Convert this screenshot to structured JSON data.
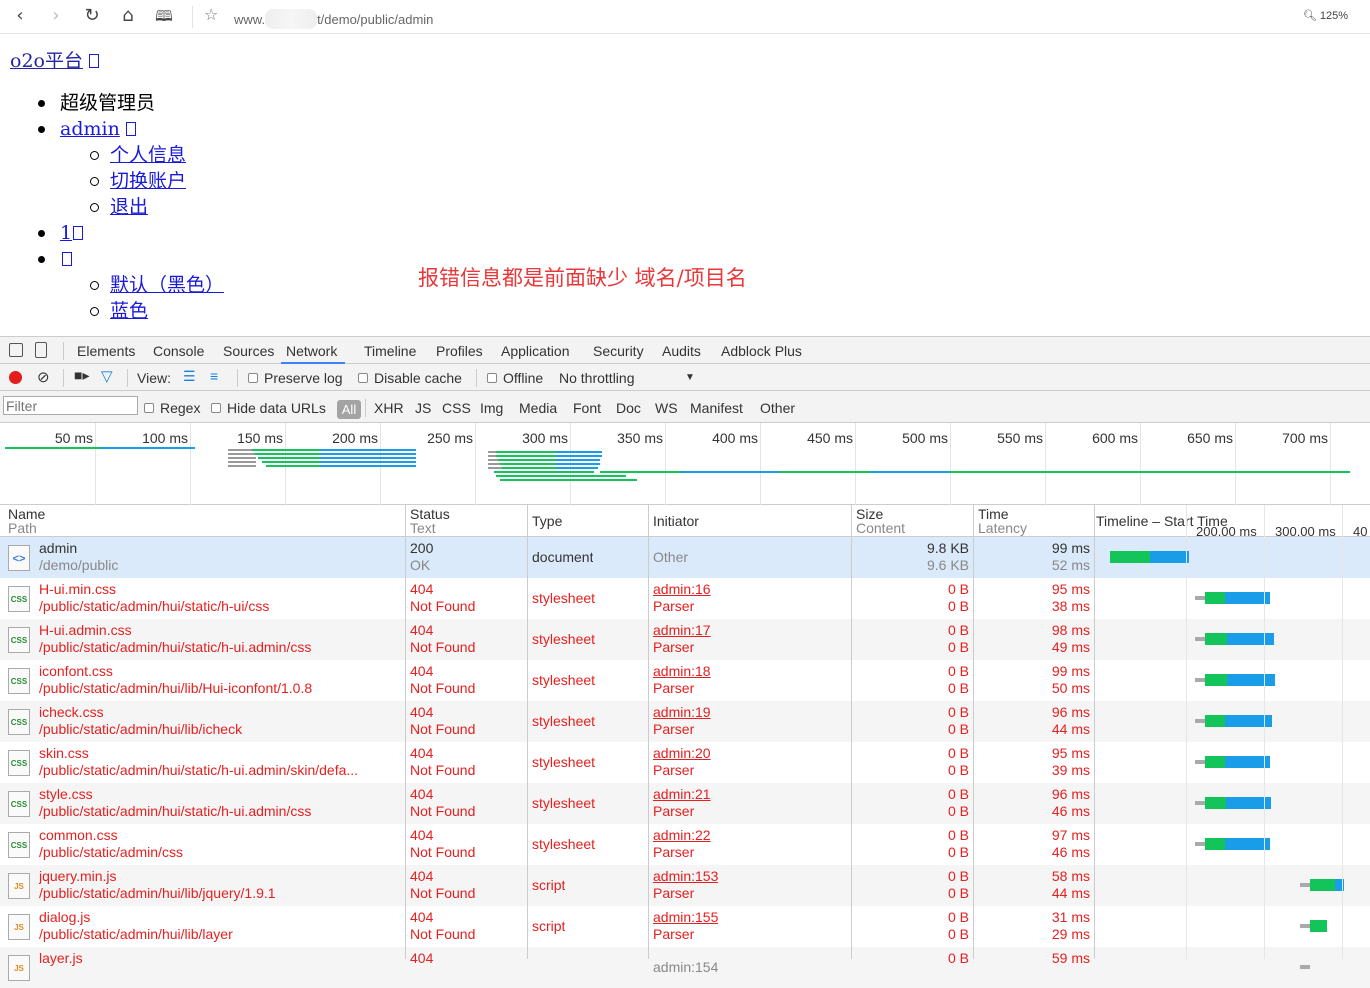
{
  "browser": {
    "url_prefix": "www.",
    "url_suffix": "t/demo/public/admin",
    "zoom": "125%"
  },
  "page": {
    "logo": "o2o平台",
    "menu": {
      "role": "超级管理员",
      "user": "admin",
      "user_items": [
        "个人信息",
        "切换账户",
        "退出"
      ],
      "count": "1",
      "skin_items": [
        "默认（黑色）",
        "蓝色"
      ]
    },
    "note": "报错信息都是前面缺少 域名/项目名"
  },
  "devtools": {
    "tabs": [
      "Elements",
      "Console",
      "Sources",
      "Network",
      "Timeline",
      "Profiles",
      "Application",
      "Security",
      "Audits",
      "Adblock Plus"
    ],
    "active_tab": "Network",
    "toolbar": {
      "view": "View:",
      "preserve_log": "Preserve log",
      "disable_cache": "Disable cache",
      "offline": "Offline",
      "throttling": "No throttling"
    },
    "filter": {
      "placeholder": "Filter",
      "regex": "Regex",
      "hide_data_urls": "Hide data URLs",
      "all": "All",
      "types": [
        "XHR",
        "JS",
        "CSS",
        "Img",
        "Media",
        "Font",
        "Doc",
        "WS",
        "Manifest",
        "Other"
      ]
    },
    "overview_ticks": [
      "50 ms",
      "100 ms",
      "150 ms",
      "200 ms",
      "250 ms",
      "300 ms",
      "350 ms",
      "400 ms",
      "450 ms",
      "500 ms",
      "550 ms",
      "600 ms",
      "650 ms",
      "700 ms"
    ],
    "columns": {
      "name": "Name",
      "name_sub": "Path",
      "status": "Status",
      "status_sub": "Text",
      "type": "Type",
      "initiator": "Initiator",
      "size": "Size",
      "size_sub": "Content",
      "time": "Time",
      "time_sub": "Latency",
      "timeline": "Timeline – Start Time",
      "timeline_ticks": [
        "200.00 ms",
        "300.00 ms",
        "40"
      ]
    },
    "requests": [
      {
        "icon": "doc",
        "name": "admin",
        "path": "/demo/public",
        "status": "200",
        "status_text": "OK",
        "type": "document",
        "initiator": "Other",
        "initiator_sub": "",
        "size": "9.8 KB",
        "content": "9.6 KB",
        "time": "99 ms",
        "latency": "52 ms",
        "wf_start": 0,
        "wf_wait": 99,
        "wf_recv": 52
      },
      {
        "icon": "css",
        "name": "H-ui.min.css",
        "path": "/public/static/admin/hui/static/h-ui/css",
        "status": "404",
        "status_text": "Not Found",
        "type": "stylesheet",
        "initiator": "admin:16",
        "initiator_sub": "Parser",
        "size": "0 B",
        "content": "0 B",
        "time": "95 ms",
        "latency": "38 ms",
        "wf_start": 100,
        "wf_wait": 25,
        "wf_recv": 60
      },
      {
        "icon": "css",
        "name": "H-ui.admin.css",
        "path": "/public/static/admin/hui/static/h-ui.admin/css",
        "status": "404",
        "status_text": "Not Found",
        "type": "stylesheet",
        "initiator": "admin:17",
        "initiator_sub": "Parser",
        "size": "0 B",
        "content": "0 B",
        "time": "98 ms",
        "latency": "49 ms",
        "wf_start": 100,
        "wf_wait": 28,
        "wf_recv": 62
      },
      {
        "icon": "css",
        "name": "iconfont.css",
        "path": "/public/static/admin/hui/lib/Hui-iconfont/1.0.8",
        "status": "404",
        "status_text": "Not Found",
        "type": "stylesheet",
        "initiator": "admin:18",
        "initiator_sub": "Parser",
        "size": "0 B",
        "content": "0 B",
        "time": "99 ms",
        "latency": "50 ms",
        "wf_start": 100,
        "wf_wait": 28,
        "wf_recv": 64
      },
      {
        "icon": "css",
        "name": "icheck.css",
        "path": "/public/static/admin/hui/lib/icheck",
        "status": "404",
        "status_text": "Not Found",
        "type": "stylesheet",
        "initiator": "admin:19",
        "initiator_sub": "Parser",
        "size": "0 B",
        "content": "0 B",
        "time": "96 ms",
        "latency": "44 ms",
        "wf_start": 100,
        "wf_wait": 25,
        "wf_recv": 62
      },
      {
        "icon": "css",
        "name": "skin.css",
        "path": "/public/static/admin/hui/static/h-ui.admin/skin/defa...",
        "status": "404",
        "status_text": "Not Found",
        "type": "stylesheet",
        "initiator": "admin:20",
        "initiator_sub": "Parser",
        "size": "0 B",
        "content": "0 B",
        "time": "95 ms",
        "latency": "39 ms",
        "wf_start": 100,
        "wf_wait": 25,
        "wf_recv": 60
      },
      {
        "icon": "css",
        "name": "style.css",
        "path": "/public/static/admin/hui/static/h-ui.admin/css",
        "status": "404",
        "status_text": "Not Found",
        "type": "stylesheet",
        "initiator": "admin:21",
        "initiator_sub": "Parser",
        "size": "0 B",
        "content": "0 B",
        "time": "96 ms",
        "latency": "46 ms",
        "wf_start": 100,
        "wf_wait": 26,
        "wf_recv": 60
      },
      {
        "icon": "css",
        "name": "common.css",
        "path": "/public/static/admin/css",
        "status": "404",
        "status_text": "Not Found",
        "type": "stylesheet",
        "initiator": "admin:22",
        "initiator_sub": "Parser",
        "size": "0 B",
        "content": "0 B",
        "time": "97 ms",
        "latency": "46 ms",
        "wf_start": 100,
        "wf_wait": 25,
        "wf_recv": 60
      },
      {
        "icon": "js",
        "name": "jquery.min.js",
        "path": "/public/static/admin/hui/lib/jquery/1.9.1",
        "status": "404",
        "status_text": "Not Found",
        "type": "script",
        "initiator": "admin:153",
        "initiator_sub": "Parser",
        "size": "0 B",
        "content": "0 B",
        "time": "58 ms",
        "latency": "44 ms",
        "wf_start": 210,
        "wf_wait": 32,
        "wf_recv": 12
      },
      {
        "icon": "js",
        "name": "dialog.js",
        "path": "/public/static/admin/hui/lib/layer",
        "status": "404",
        "status_text": "Not Found",
        "type": "script",
        "initiator": "admin:155",
        "initiator_sub": "Parser",
        "size": "0 B",
        "content": "0 B",
        "time": "31 ms",
        "latency": "29 ms",
        "wf_start": 210,
        "wf_wait": 22,
        "wf_recv": 0
      },
      {
        "icon": "js",
        "name": "layer.js",
        "path": "",
        "status": "404",
        "status_text": "",
        "type": "",
        "initiator": "admin:154",
        "initiator_sub": "",
        "size": "0 B",
        "content": "",
        "time": "59 ms",
        "latency": "",
        "wf_start": 210,
        "wf_wait": 30,
        "wf_recv": 10
      }
    ],
    "colors": {
      "wait": "#13c45a",
      "receive": "#1a9de8",
      "error": "#e52020",
      "selected": "#dbeafa"
    }
  }
}
